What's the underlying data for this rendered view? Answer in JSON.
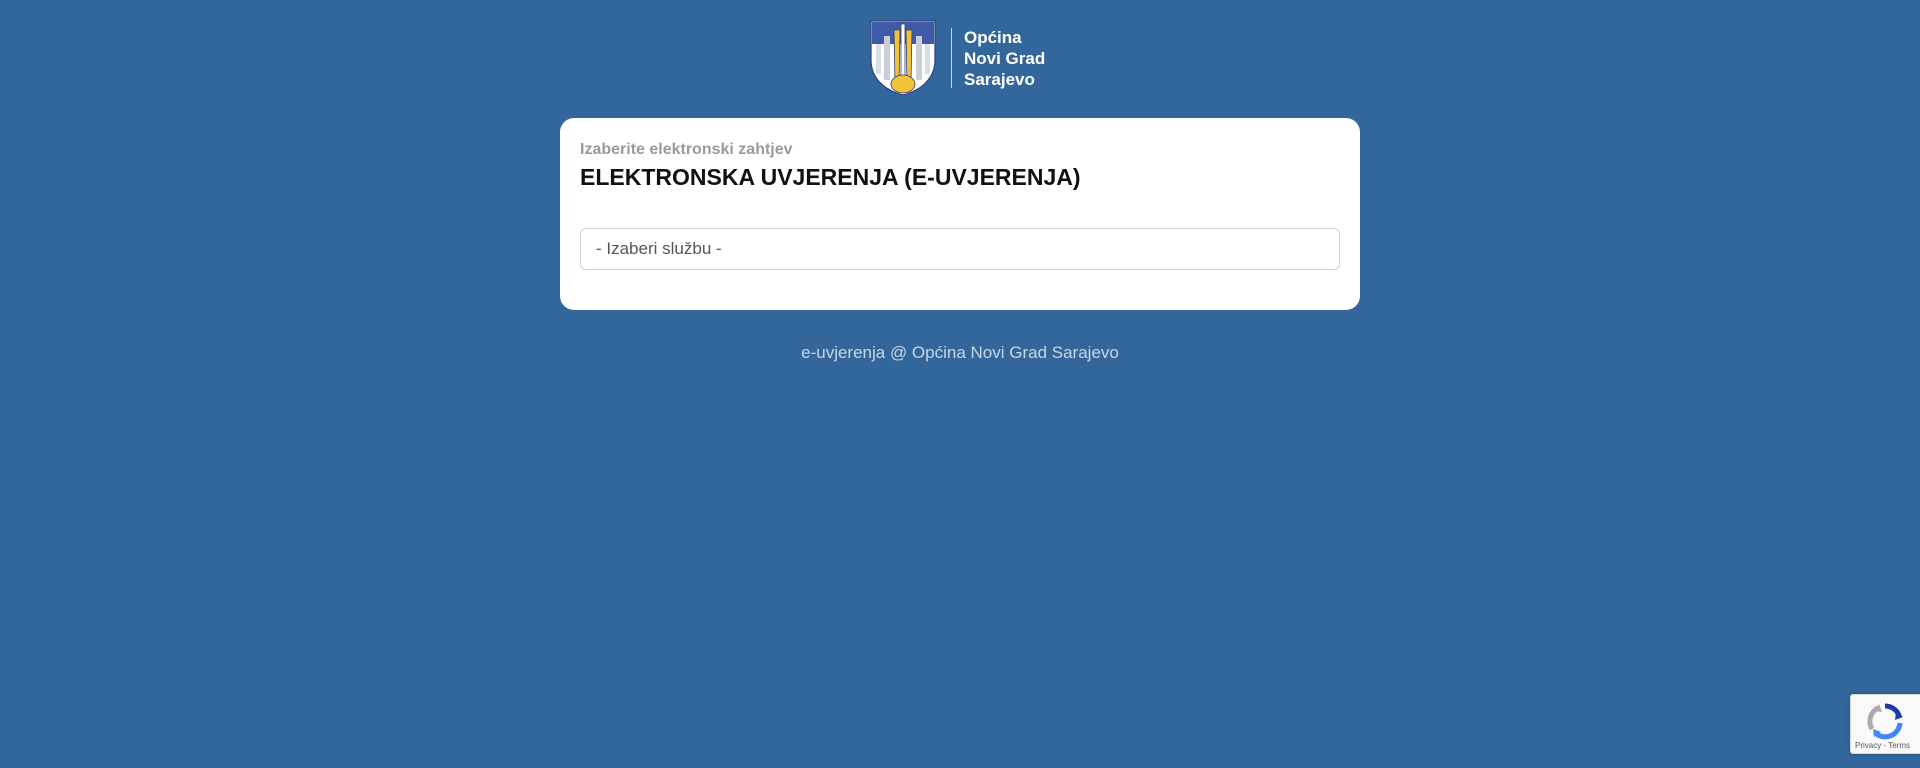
{
  "header": {
    "logo_lines": [
      "Općina",
      "Novi Grad",
      "Sarajevo"
    ],
    "crest_icon": "municipality-crest-icon"
  },
  "card": {
    "subtitle": "Izaberite elektronski zahtjev",
    "title": "ELEKTRONSKA UVJERENJA (E-UVJERENJA)",
    "select": {
      "selected_value": "- Izaberi službu -"
    }
  },
  "footer": {
    "text": "e-uvjerenja @ Općina Novi Grad Sarajevo"
  },
  "recaptcha": {
    "icon": "recaptcha-icon",
    "privacy_label": "Privacy",
    "separator": " - ",
    "terms_label": "Terms"
  },
  "colors": {
    "background": "#33679b",
    "card": "#ffffff",
    "crest_blue": "#3f5ba8",
    "crest_yellow": "#f2c23a"
  }
}
